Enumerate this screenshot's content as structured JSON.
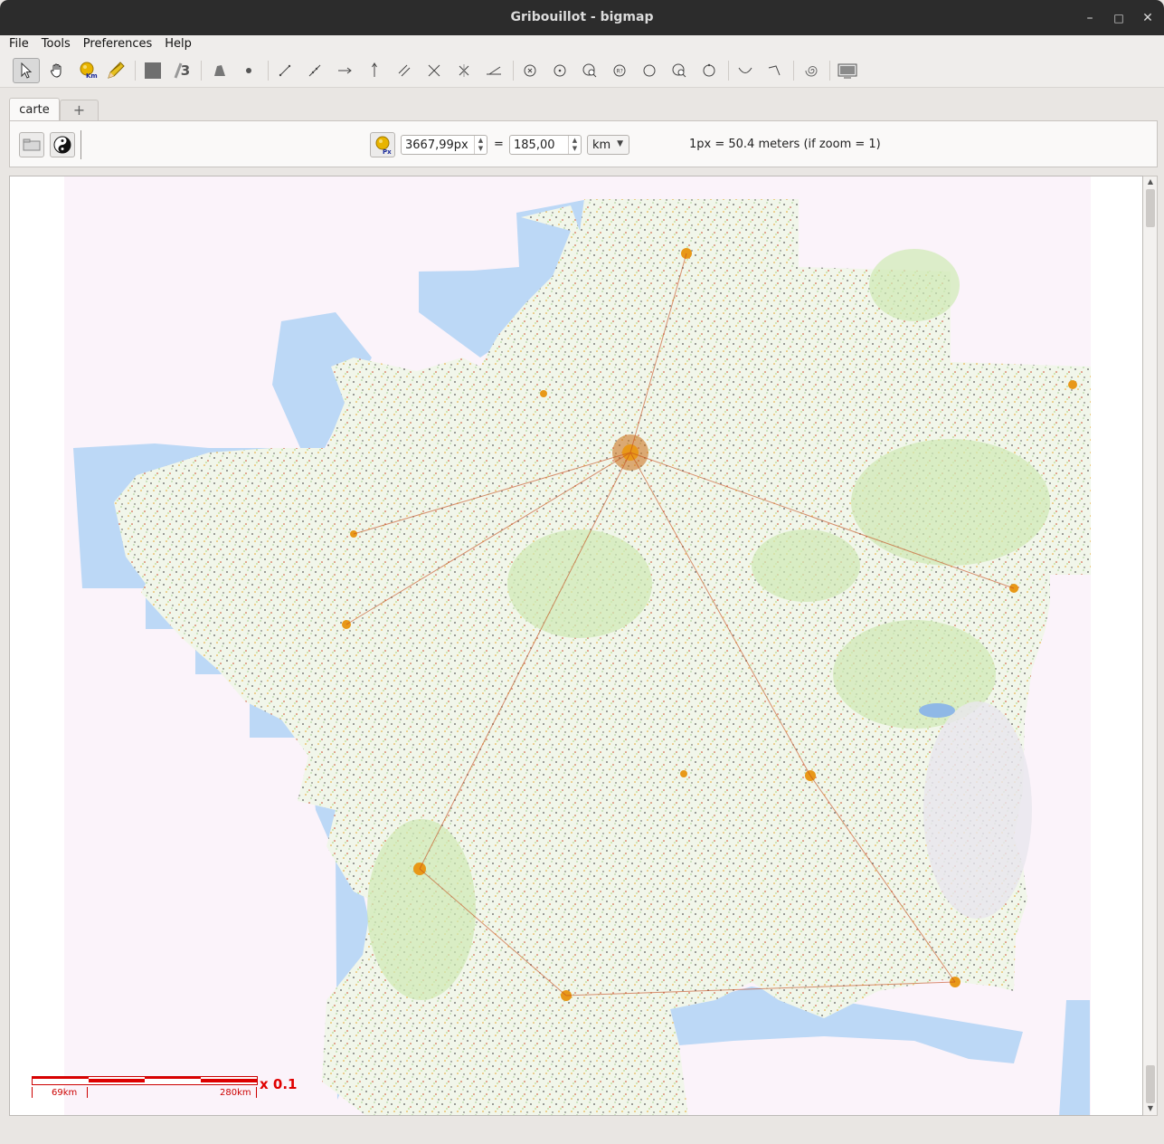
{
  "window": {
    "title": "Gribouillot - bigmap"
  },
  "menu": [
    "File",
    "Tools",
    "Preferences",
    "Help"
  ],
  "toolbar": {
    "scale_badge": "Km",
    "layer_number": "3",
    "icons": [
      "pointer-icon",
      "hand-pan-icon",
      "km-scale-icon",
      "pencil-icon",
      "square-fill-icon",
      "layer-3-icon",
      "triangle-icon",
      "point-icon",
      "segment-icon",
      "line-icon",
      "ray-icon",
      "vertical-line-icon",
      "parallel-icon",
      "perpendicular-icon",
      "bisector-icon",
      "angle-icon",
      "circle-cross-icon",
      "circle-dot-icon",
      "circle-search-icon",
      "circle-radius-icon",
      "circle-icon",
      "circle-search-2-icon",
      "circle-arc-icon",
      "curve-icon",
      "arc-icon",
      "spiral-icon",
      "screen-icon"
    ]
  },
  "tabs": {
    "active": "carte",
    "add": "+"
  },
  "scale_panel": {
    "badge": "Px",
    "pixels": "3667,99px",
    "equals": "=",
    "distance": "185,00",
    "unit": "km",
    "info": "1px = 50.4 meters (if zoom = 1)"
  },
  "scalebar": {
    "label_left": "69km",
    "label_right": "280km",
    "multiplier": "x 0.1"
  },
  "colors": {
    "sea": "#bcd8f6",
    "land": "#eaf3dc",
    "map_background": "#fbf3fa",
    "scale_red": "#dd0000"
  }
}
